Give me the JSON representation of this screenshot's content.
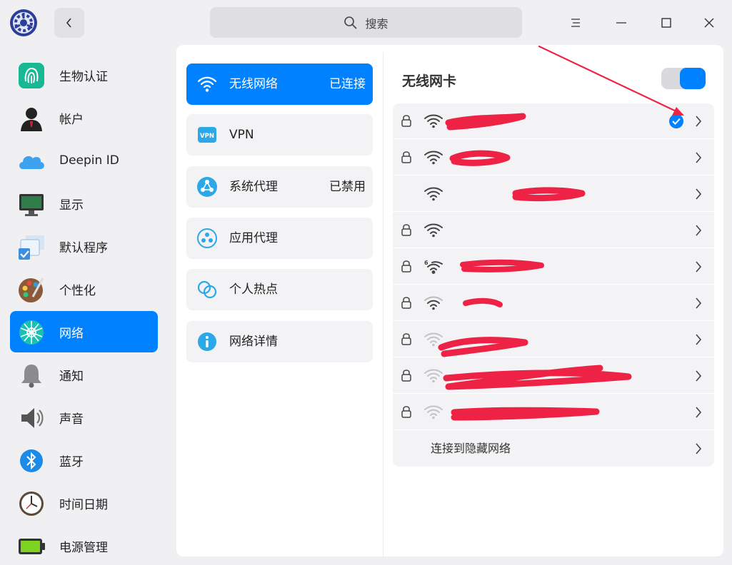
{
  "window": {
    "title": ""
  },
  "search": {
    "placeholder": "搜索",
    "icon": "search-icon"
  },
  "sidebar": {
    "items": [
      {
        "label": "生物认证",
        "icon": "fingerprint-icon"
      },
      {
        "label": "帐户",
        "icon": "account-icon"
      },
      {
        "label": "Deepin ID",
        "icon": "cloud-icon"
      },
      {
        "label": "显示",
        "icon": "monitor-icon"
      },
      {
        "label": "默认程序",
        "icon": "default-apps-icon"
      },
      {
        "label": "个性化",
        "icon": "palette-icon"
      },
      {
        "label": "网络",
        "icon": "network-icon",
        "active": true
      },
      {
        "label": "通知",
        "icon": "bell-icon"
      },
      {
        "label": "声音",
        "icon": "speaker-icon"
      },
      {
        "label": "蓝牙",
        "icon": "bluetooth-icon"
      },
      {
        "label": "时间日期",
        "icon": "clock-icon"
      },
      {
        "label": "电源管理",
        "icon": "battery-icon"
      }
    ]
  },
  "network_menu": {
    "items": [
      {
        "label": "无线网络",
        "status": "已连接",
        "icon": "wifi-icon",
        "active": true
      },
      {
        "label": "VPN",
        "status": "",
        "icon": "vpn-icon"
      },
      {
        "label": "系统代理",
        "status": "已禁用",
        "icon": "system-proxy-icon"
      },
      {
        "label": "应用代理",
        "status": "",
        "icon": "app-proxy-icon"
      },
      {
        "label": "个人热点",
        "status": "",
        "icon": "hotspot-icon"
      },
      {
        "label": "网络详情",
        "status": "",
        "icon": "info-icon"
      }
    ]
  },
  "wlan": {
    "title": "无线网卡",
    "enabled": true,
    "networks": [
      {
        "secured": true,
        "signal": "full",
        "connected": true
      },
      {
        "secured": true,
        "signal": "full",
        "connected": false
      },
      {
        "secured": false,
        "signal": "full",
        "connected": false
      },
      {
        "secured": true,
        "signal": "full",
        "connected": false
      },
      {
        "secured": true,
        "signal": "full",
        "connected": false,
        "badge": "6"
      },
      {
        "secured": true,
        "signal": "medium",
        "connected": false
      },
      {
        "secured": true,
        "signal": "weak",
        "connected": false
      },
      {
        "secured": true,
        "signal": "weak",
        "connected": false
      },
      {
        "secured": true,
        "signal": "weak",
        "connected": false
      }
    ],
    "hidden_network_label": "连接到隐藏网络"
  },
  "colors": {
    "accent": "#0081ff",
    "annotation": "#ee2244"
  }
}
